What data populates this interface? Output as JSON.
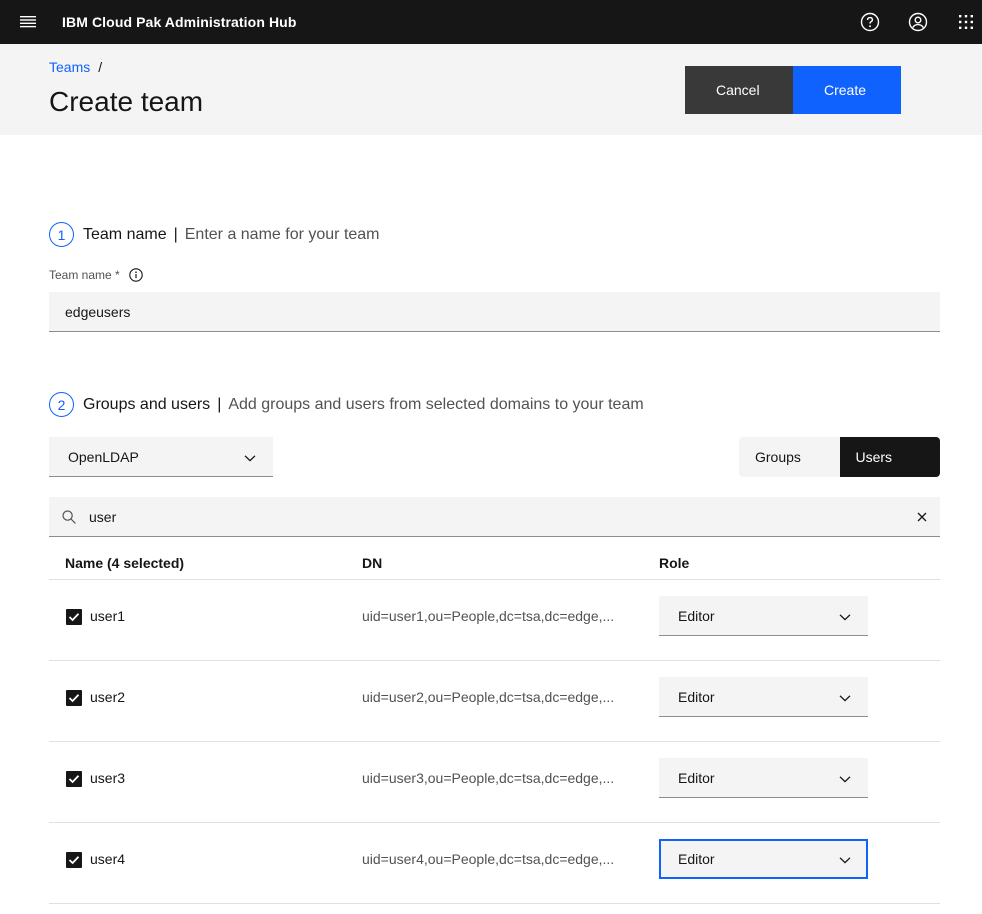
{
  "topbar": {
    "brand_prefix": "IBM",
    "brand_name": "Cloud Pak Administration Hub"
  },
  "breadcrumb": {
    "parent": "Teams",
    "separator": "/"
  },
  "page": {
    "title": "Create team"
  },
  "actions": {
    "cancel_label": "Cancel",
    "create_label": "Create"
  },
  "step1": {
    "number": "1",
    "title": "Team name",
    "divider": "|",
    "description": "Enter a name for your team",
    "field_label": "Team name *",
    "field_value": "edgeusers"
  },
  "step2": {
    "number": "2",
    "title": "Groups and users",
    "divider": "|",
    "description": "Add groups and users from selected domains to your team",
    "domain_selected": "OpenLDAP",
    "switcher": {
      "groups_label": "Groups",
      "users_label": "Users",
      "active": "Users"
    },
    "search_value": "user"
  },
  "table": {
    "headers": {
      "name": "Name (4 selected)",
      "dn": "DN",
      "role": "Role"
    },
    "rows": [
      {
        "name": "user1",
        "dn": "uid=user1,ou=People,dc=tsa,dc=edge,...",
        "role": "Editor",
        "checked": true
      },
      {
        "name": "user2",
        "dn": "uid=user2,ou=People,dc=tsa,dc=edge,...",
        "role": "Editor",
        "checked": true
      },
      {
        "name": "user3",
        "dn": "uid=user3,ou=People,dc=tsa,dc=edge,...",
        "role": "Editor",
        "checked": true
      },
      {
        "name": "user4",
        "dn": "uid=user4,ou=People,dc=tsa,dc=edge,...",
        "role": "Editor",
        "checked": true
      }
    ]
  },
  "icons": {
    "menu": "hamburger-menu-icon",
    "help": "help-icon",
    "user": "user-avatar-icon",
    "switcher": "app-switcher-icon",
    "info": "info-icon",
    "search": "search-icon",
    "clear": "close-icon",
    "chevron": "chevron-down-icon",
    "checkbox": "checkmark-icon"
  },
  "colors": {
    "primary": "#0f62fe",
    "topbar": "#161616",
    "secondary_button": "#393939",
    "field_background": "#f4f4f4"
  }
}
